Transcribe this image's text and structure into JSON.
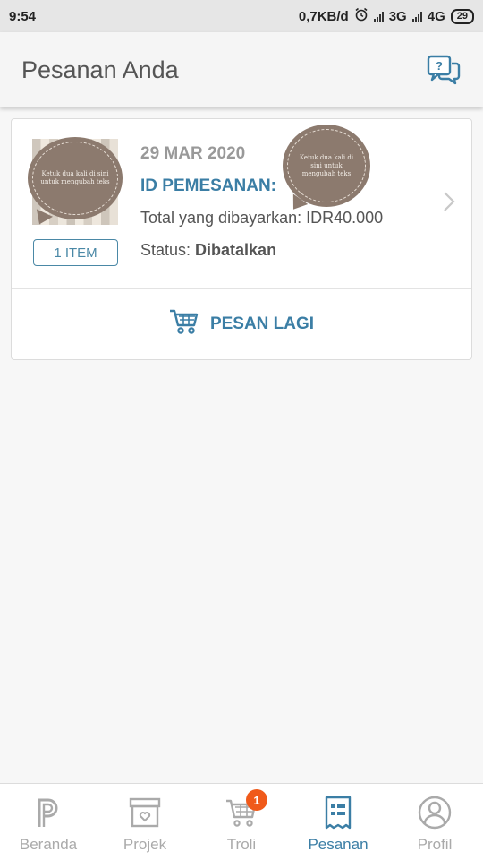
{
  "status_bar": {
    "time": "9:54",
    "network_speed": "0,7KB/d",
    "network_3g": "3G",
    "network_4g": "4G",
    "battery": "29",
    "alarm_icon": "alarm-clock-icon"
  },
  "header": {
    "title": "Pesanan Anda",
    "help_icon": "help-chat-icon"
  },
  "order": {
    "date": "29 MAR 2020",
    "id_label": "ID PEMESANAN:",
    "total_text": "Total yang dibayarkan: IDR40.000",
    "status_label": "Status: ",
    "status_value": "Dibatalkan",
    "item_badge": "1 ITEM",
    "sticker_text_1": "Ketuk dua kali di sini untuk mengubah teks",
    "sticker_text_2": "Ketuk dua kali di sini untuk mengubah teks",
    "reorder_label": "PESAN LAGI"
  },
  "bottom_nav": {
    "items": [
      {
        "label": "Beranda",
        "icon": "home-logo-icon"
      },
      {
        "label": "Projek",
        "icon": "project-box-icon"
      },
      {
        "label": "Troli",
        "icon": "cart-icon",
        "badge": "1"
      },
      {
        "label": "Pesanan",
        "icon": "orders-icon"
      },
      {
        "label": "Profil",
        "icon": "profile-icon"
      }
    ],
    "active_index": 3
  },
  "colors": {
    "accent": "#3b7ea5",
    "badge": "#f05a1a",
    "muted": "#aaaaaa"
  }
}
